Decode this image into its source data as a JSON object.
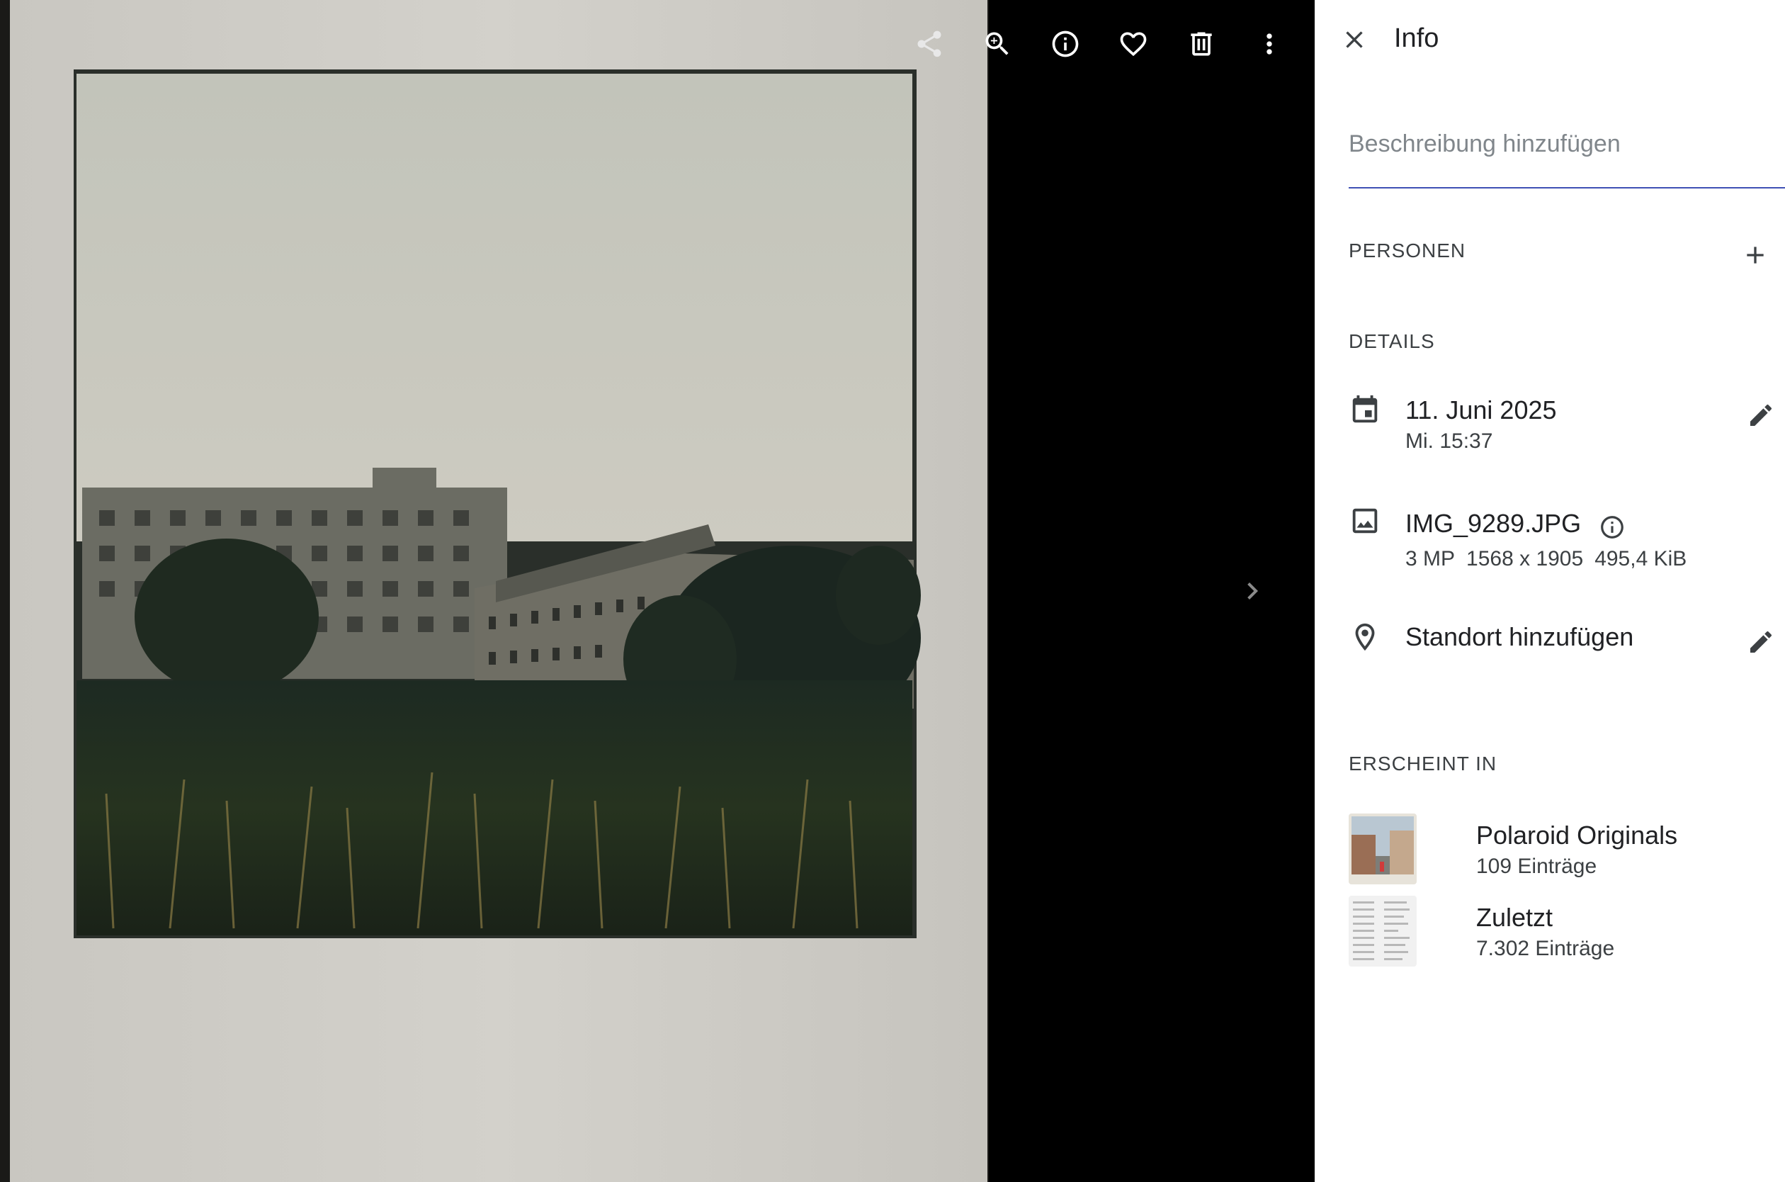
{
  "toolbar": {
    "icons": [
      "share-icon",
      "zoom-in-icon",
      "info-icon",
      "heart-icon",
      "delete-icon",
      "more-vert-icon"
    ]
  },
  "viewer": {
    "next_icon": "chevron-right-icon"
  },
  "panel": {
    "title": "Info",
    "description_placeholder": "Beschreibung hinzufügen",
    "people_heading": "PERSONEN",
    "details_heading": "DETAILS",
    "date": "11. Juni 2025",
    "time": "Mi. 15:37",
    "filename": "IMG_9289.JPG",
    "megapixels": "3 MP",
    "resolution": "1568 x 1905",
    "filesize": "495,4 KiB",
    "location": "Standort hinzufügen",
    "appears_heading": "ERSCHEINT IN",
    "albums": [
      {
        "name": "Polaroid Originals",
        "count": "109 Einträge"
      },
      {
        "name": "Zuletzt",
        "count": "7.302 Einträge"
      }
    ]
  },
  "colors": {
    "panel_bg": "#ffffff",
    "viewer_bg": "#000000",
    "accent_underline": "#3f51b5"
  }
}
